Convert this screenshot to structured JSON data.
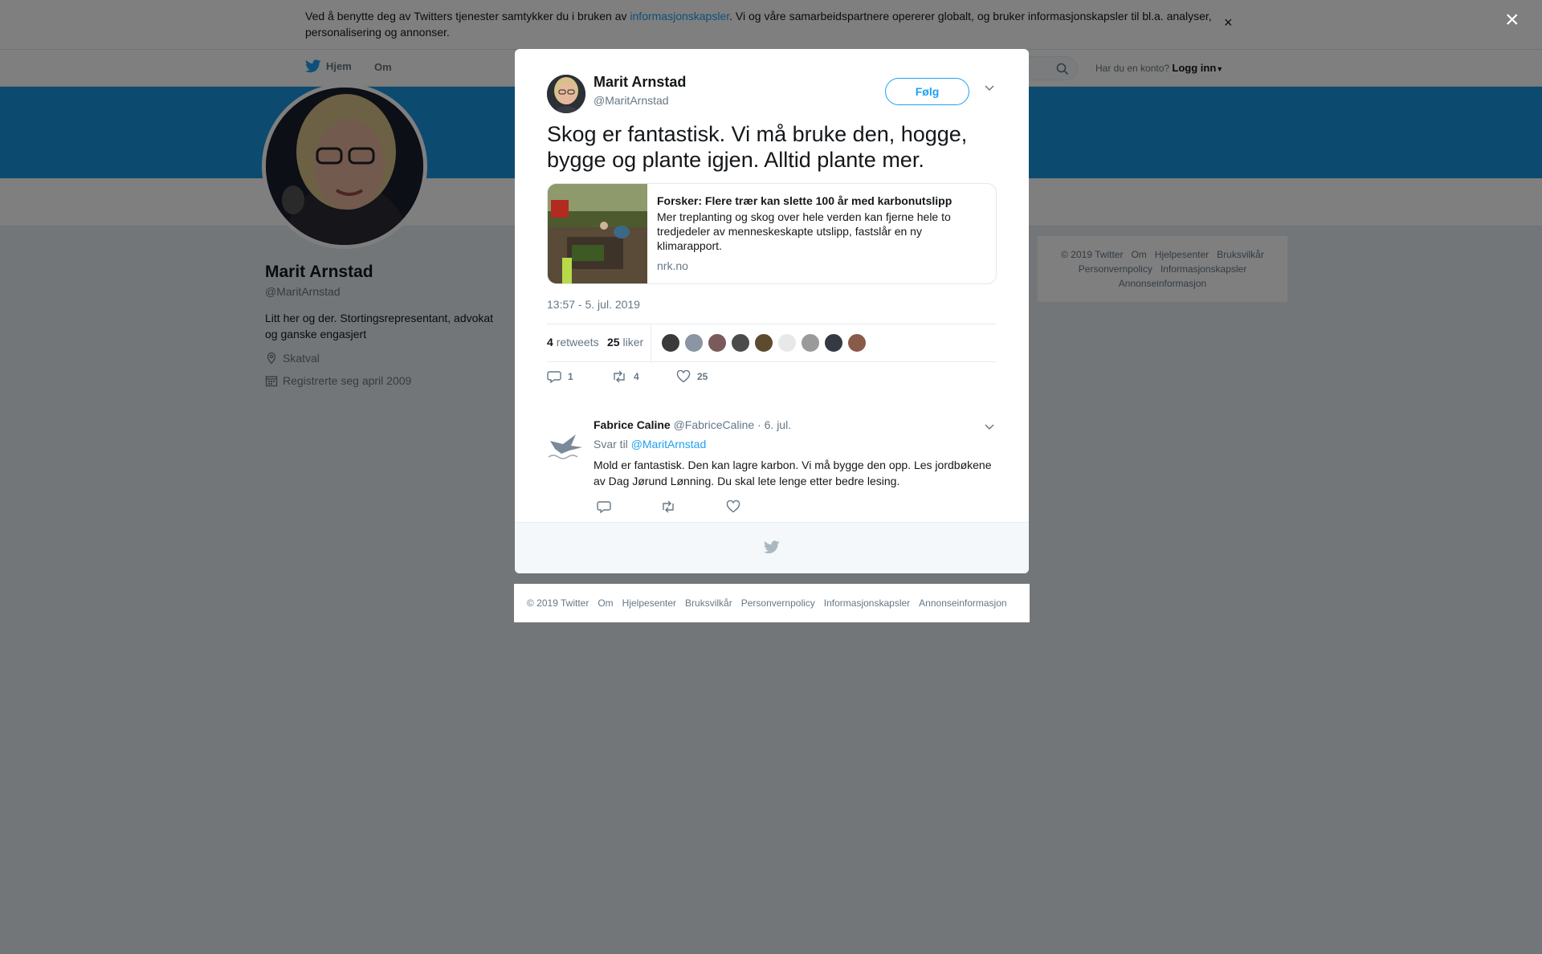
{
  "cookie_banner": {
    "text_before": "Ved å benytte deg av Twitters tjenester samtykker du i bruken av ",
    "link": "informasjonskapsler",
    "text_after": ". Vi og våre samarbeidspartnere opererer globalt, og bruker informasjonskapsler til bl.a. analyser, personalisering og annonser.",
    "close": "×"
  },
  "nav": {
    "home": "Hjem",
    "about": "Om",
    "login_prompt": "Har du en konto?",
    "login": "Logg inn"
  },
  "profile": {
    "name": "Marit Arnstad",
    "handle": "@MaritArnstad",
    "bio": "Litt her og der. Stortingsrepresentant, advokat og ganske engasjert",
    "location": "Skatval",
    "joined": "Registrerte seg april 2009"
  },
  "side_footer": {
    "links": [
      "© 2019 Twitter",
      "Om",
      "Hjelpesenter",
      "Bruksvilkår",
      "Personvernpolicy",
      "Informasjonskapsler",
      "Annonseinformasjon"
    ]
  },
  "overlay": {
    "close": "×"
  },
  "tweet": {
    "author_name": "Marit Arnstad",
    "author_handle": "@MaritArnstad",
    "follow": "Følg",
    "text": "Skog er fantastisk. Vi må bruke den, hogge, bygge og plante igjen. Alltid plante mer.",
    "card": {
      "title": "Forsker: Flere trær kan slette 100 år med karbonutslipp",
      "description": "Mer treplanting og skog over hele verden kan fjerne hele to tredjedeler av menneskeskapte utslipp, fastslår en ny klimarapport.",
      "domain": "nrk.no"
    },
    "timestamp": "13:57 - 5. jul. 2019",
    "retweets_count": "4",
    "retweets_label": "retweets",
    "likes_count": "25",
    "likes_label": "liker",
    "liker_colors": [
      "#3a3a3a",
      "#8b95a3",
      "#7a5a5a",
      "#4b4b4b",
      "#5e4a2e",
      "#e8e8e8",
      "#9a9a9a",
      "#333a44",
      "#8a5a48"
    ],
    "action_reply_count": "1",
    "action_retweet_count": "4",
    "action_like_count": "25"
  },
  "reply": {
    "author_name": "Fabrice Caline",
    "author_handle": "@FabriceCaline",
    "date": "· 6. jul.",
    "reply_to_label": "Svar til",
    "reply_to_handle": "@MaritArnstad",
    "text": "Mold er fantastisk. Den kan lagre karbon. Vi må bygge den opp. Les jordbøkene av Dag Jørund Lønning. Du skal lete lenge etter bedre lesing."
  },
  "bottom_footer": {
    "links": [
      "© 2019 Twitter",
      "Om",
      "Hjelpesenter",
      "Bruksvilkår",
      "Personvernpolicy",
      "Informasjonskapsler",
      "Annonseinformasjon"
    ]
  },
  "colors": {
    "accent": "#1da1f2",
    "banner": "#1b95e0",
    "overlay": "rgba(0,0,0,0.5)"
  }
}
